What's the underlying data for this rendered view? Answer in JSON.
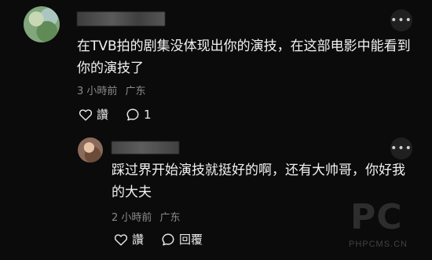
{
  "comment": {
    "text": "在TVB拍的剧集没体现出你的演技，在这部电影中能看到你的演技了",
    "time": "3 小時前",
    "location": "广东",
    "like_label": "讚",
    "reply_count": "1"
  },
  "reply": {
    "text": "踩过界开始演技就挺好的啊，还有大帅哥，你好我的大夫",
    "time": "2 小時前",
    "location": "广东",
    "like_label": "讚",
    "reply_label": "回覆"
  },
  "watermark": {
    "site": "PHPCMS.CN"
  },
  "icons": {
    "like": "heart-icon",
    "reply": "speech-bubble-icon",
    "more": "more-icon"
  }
}
